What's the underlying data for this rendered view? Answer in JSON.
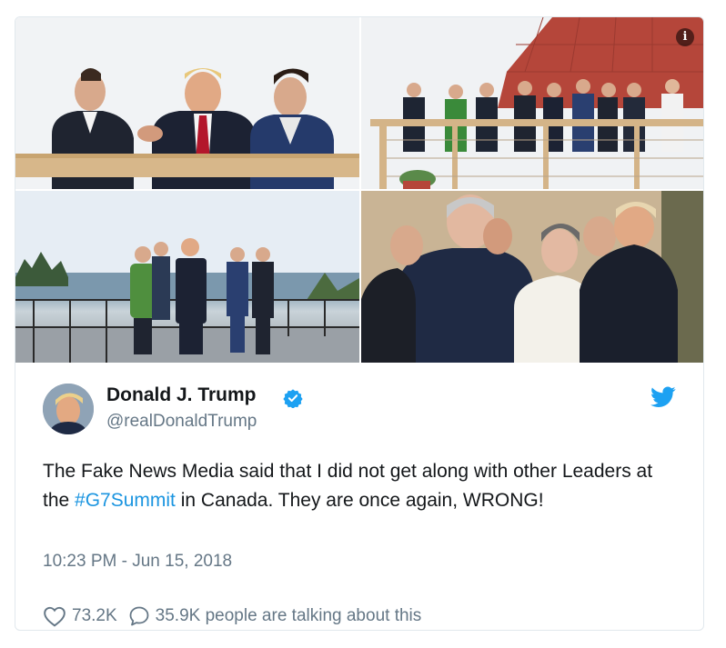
{
  "media": {
    "photos": [
      {
        "name": "photo-top-left"
      },
      {
        "name": "photo-top-right"
      },
      {
        "name": "photo-bottom-left"
      },
      {
        "name": "photo-bottom-right"
      }
    ],
    "info_icon": "info-icon"
  },
  "tweet": {
    "display_name": "Donald J. Trump",
    "handle": "@realDonaldTrump",
    "text_before": "The Fake News Media said that I did not get along with other Leaders at the ",
    "hashtag": "#G7Summit",
    "text_after": " in Canada. They are once again, WRONG!",
    "timestamp": "10:23 PM - Jun 15, 2018",
    "likes": "73.2K",
    "replies": "35.9K people are talking about this"
  },
  "colors": {
    "link": "#1b95e0",
    "muted": "#657786",
    "border": "#e1e8ed",
    "twitter_blue": "#1da1f2"
  }
}
